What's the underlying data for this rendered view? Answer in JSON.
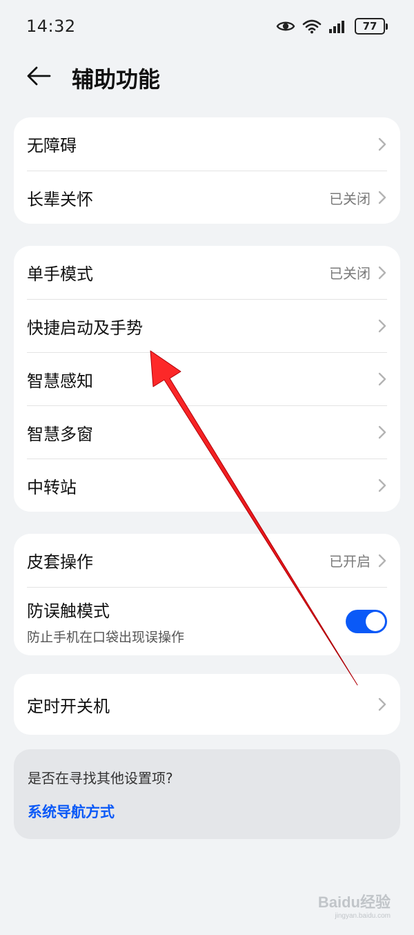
{
  "status_bar": {
    "time": "14:32",
    "battery": "77",
    "icons": [
      "eye-icon",
      "wifi-icon",
      "signal-icon",
      "battery-icon"
    ]
  },
  "header": {
    "back_icon": "arrow-left-icon",
    "title": "辅助功能"
  },
  "groups": [
    {
      "items": [
        {
          "label": "无障碍",
          "value": ""
        },
        {
          "label": "长辈关怀",
          "value": "已关闭"
        }
      ]
    },
    {
      "items": [
        {
          "label": "单手模式",
          "value": "已关闭"
        },
        {
          "label": "快捷启动及手势",
          "value": ""
        },
        {
          "label": "智慧感知",
          "value": ""
        },
        {
          "label": "智慧多窗",
          "value": ""
        },
        {
          "label": "中转站",
          "value": ""
        }
      ]
    },
    {
      "items": [
        {
          "label": "皮套操作",
          "value": "已开启"
        },
        {
          "label": "防误触模式",
          "subtitle": "防止手机在口袋出现误操作",
          "toggle_on": true
        }
      ]
    },
    {
      "items": [
        {
          "label": "定时开关机",
          "value": ""
        }
      ]
    }
  ],
  "hint": {
    "question": "是否在寻找其他设置项?",
    "link": "系统导航方式"
  },
  "colors": {
    "accent": "#0a59f7",
    "background": "#f1f3f5",
    "annotation_arrow": "#e8101a"
  },
  "watermark": {
    "main": "Baidu经验",
    "sub": "jingyan.baidu.com"
  }
}
